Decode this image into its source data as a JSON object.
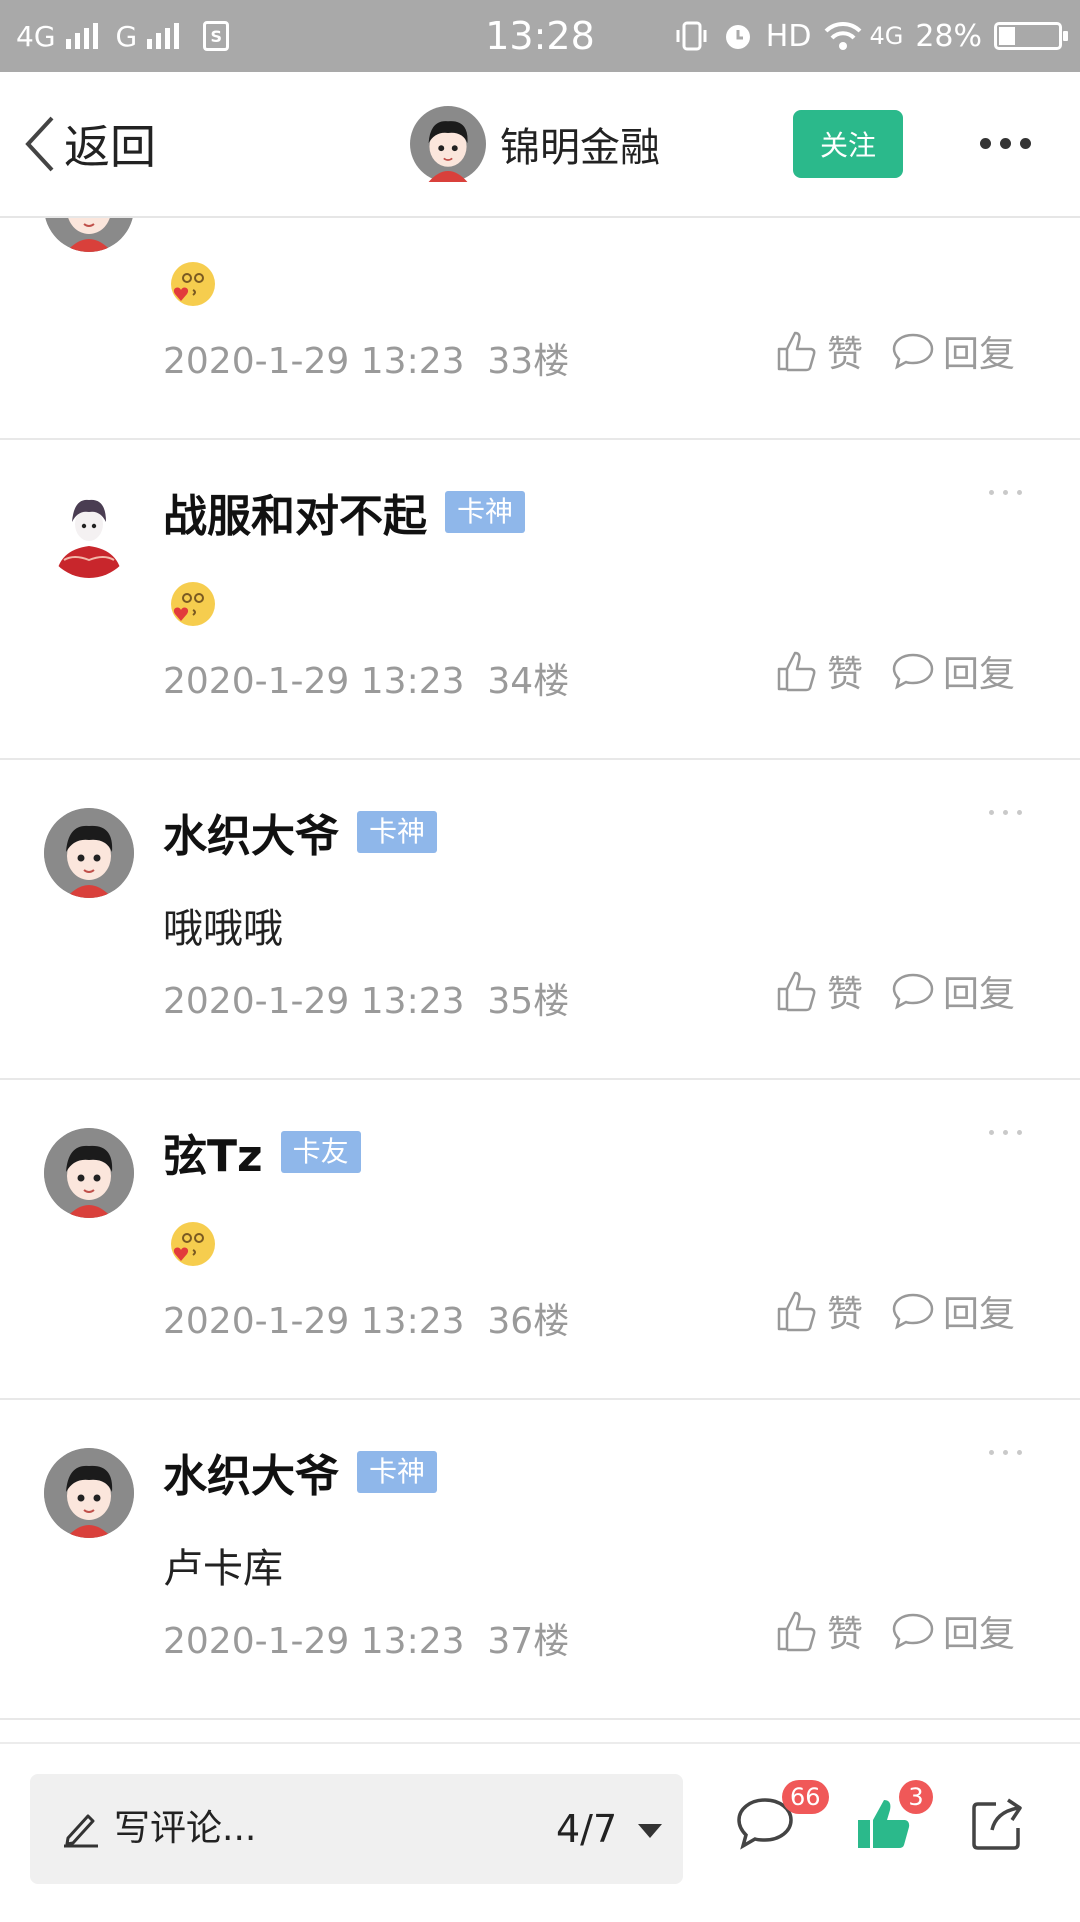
{
  "status_bar": {
    "network1": "4G",
    "network2": "G",
    "time": "13:28",
    "hd": "HD",
    "net3": "4G",
    "battery": "28%",
    "battery_level": 0.28
  },
  "nav": {
    "back_label": "返回",
    "title": "锦明金融",
    "follow_label": "关注"
  },
  "comments": [
    {
      "username": "",
      "badge": "",
      "body": "",
      "emoji": true,
      "time": "2020-1-29 13:23",
      "floor": "33楼",
      "like_label": "赞",
      "reply_label": "回复",
      "avatar": "cartoon-boy"
    },
    {
      "username": "战服和对不起",
      "badge": "卡神",
      "body": "",
      "emoji": true,
      "time": "2020-1-29 13:23",
      "floor": "34楼",
      "like_label": "赞",
      "reply_label": "回复",
      "avatar": "costume-figure"
    },
    {
      "username": "水织大爷",
      "badge": "卡神",
      "body": "哦哦哦",
      "emoji": false,
      "time": "2020-1-29 13:23",
      "floor": "35楼",
      "like_label": "赞",
      "reply_label": "回复",
      "avatar": "cartoon-boy"
    },
    {
      "username": "弦Tz",
      "badge": "卡友",
      "body": "",
      "emoji": true,
      "time": "2020-1-29 13:23",
      "floor": "36楼",
      "like_label": "赞",
      "reply_label": "回复",
      "avatar": "cartoon-boy"
    },
    {
      "username": "水织大爷",
      "badge": "卡神",
      "body": "卢卡库",
      "emoji": false,
      "time": "2020-1-29 13:23",
      "floor": "37楼",
      "like_label": "赞",
      "reply_label": "回复",
      "avatar": "cartoon-boy"
    }
  ],
  "bottom": {
    "placeholder": "写评论...",
    "pager": "4/7",
    "comment_count": "66",
    "like_count": "3"
  },
  "colors": {
    "accent_green": "#2bb98b",
    "badge_blue": "#8fb7ea",
    "count_red": "#f05858",
    "status_bar_gray": "#a9a9a9"
  }
}
